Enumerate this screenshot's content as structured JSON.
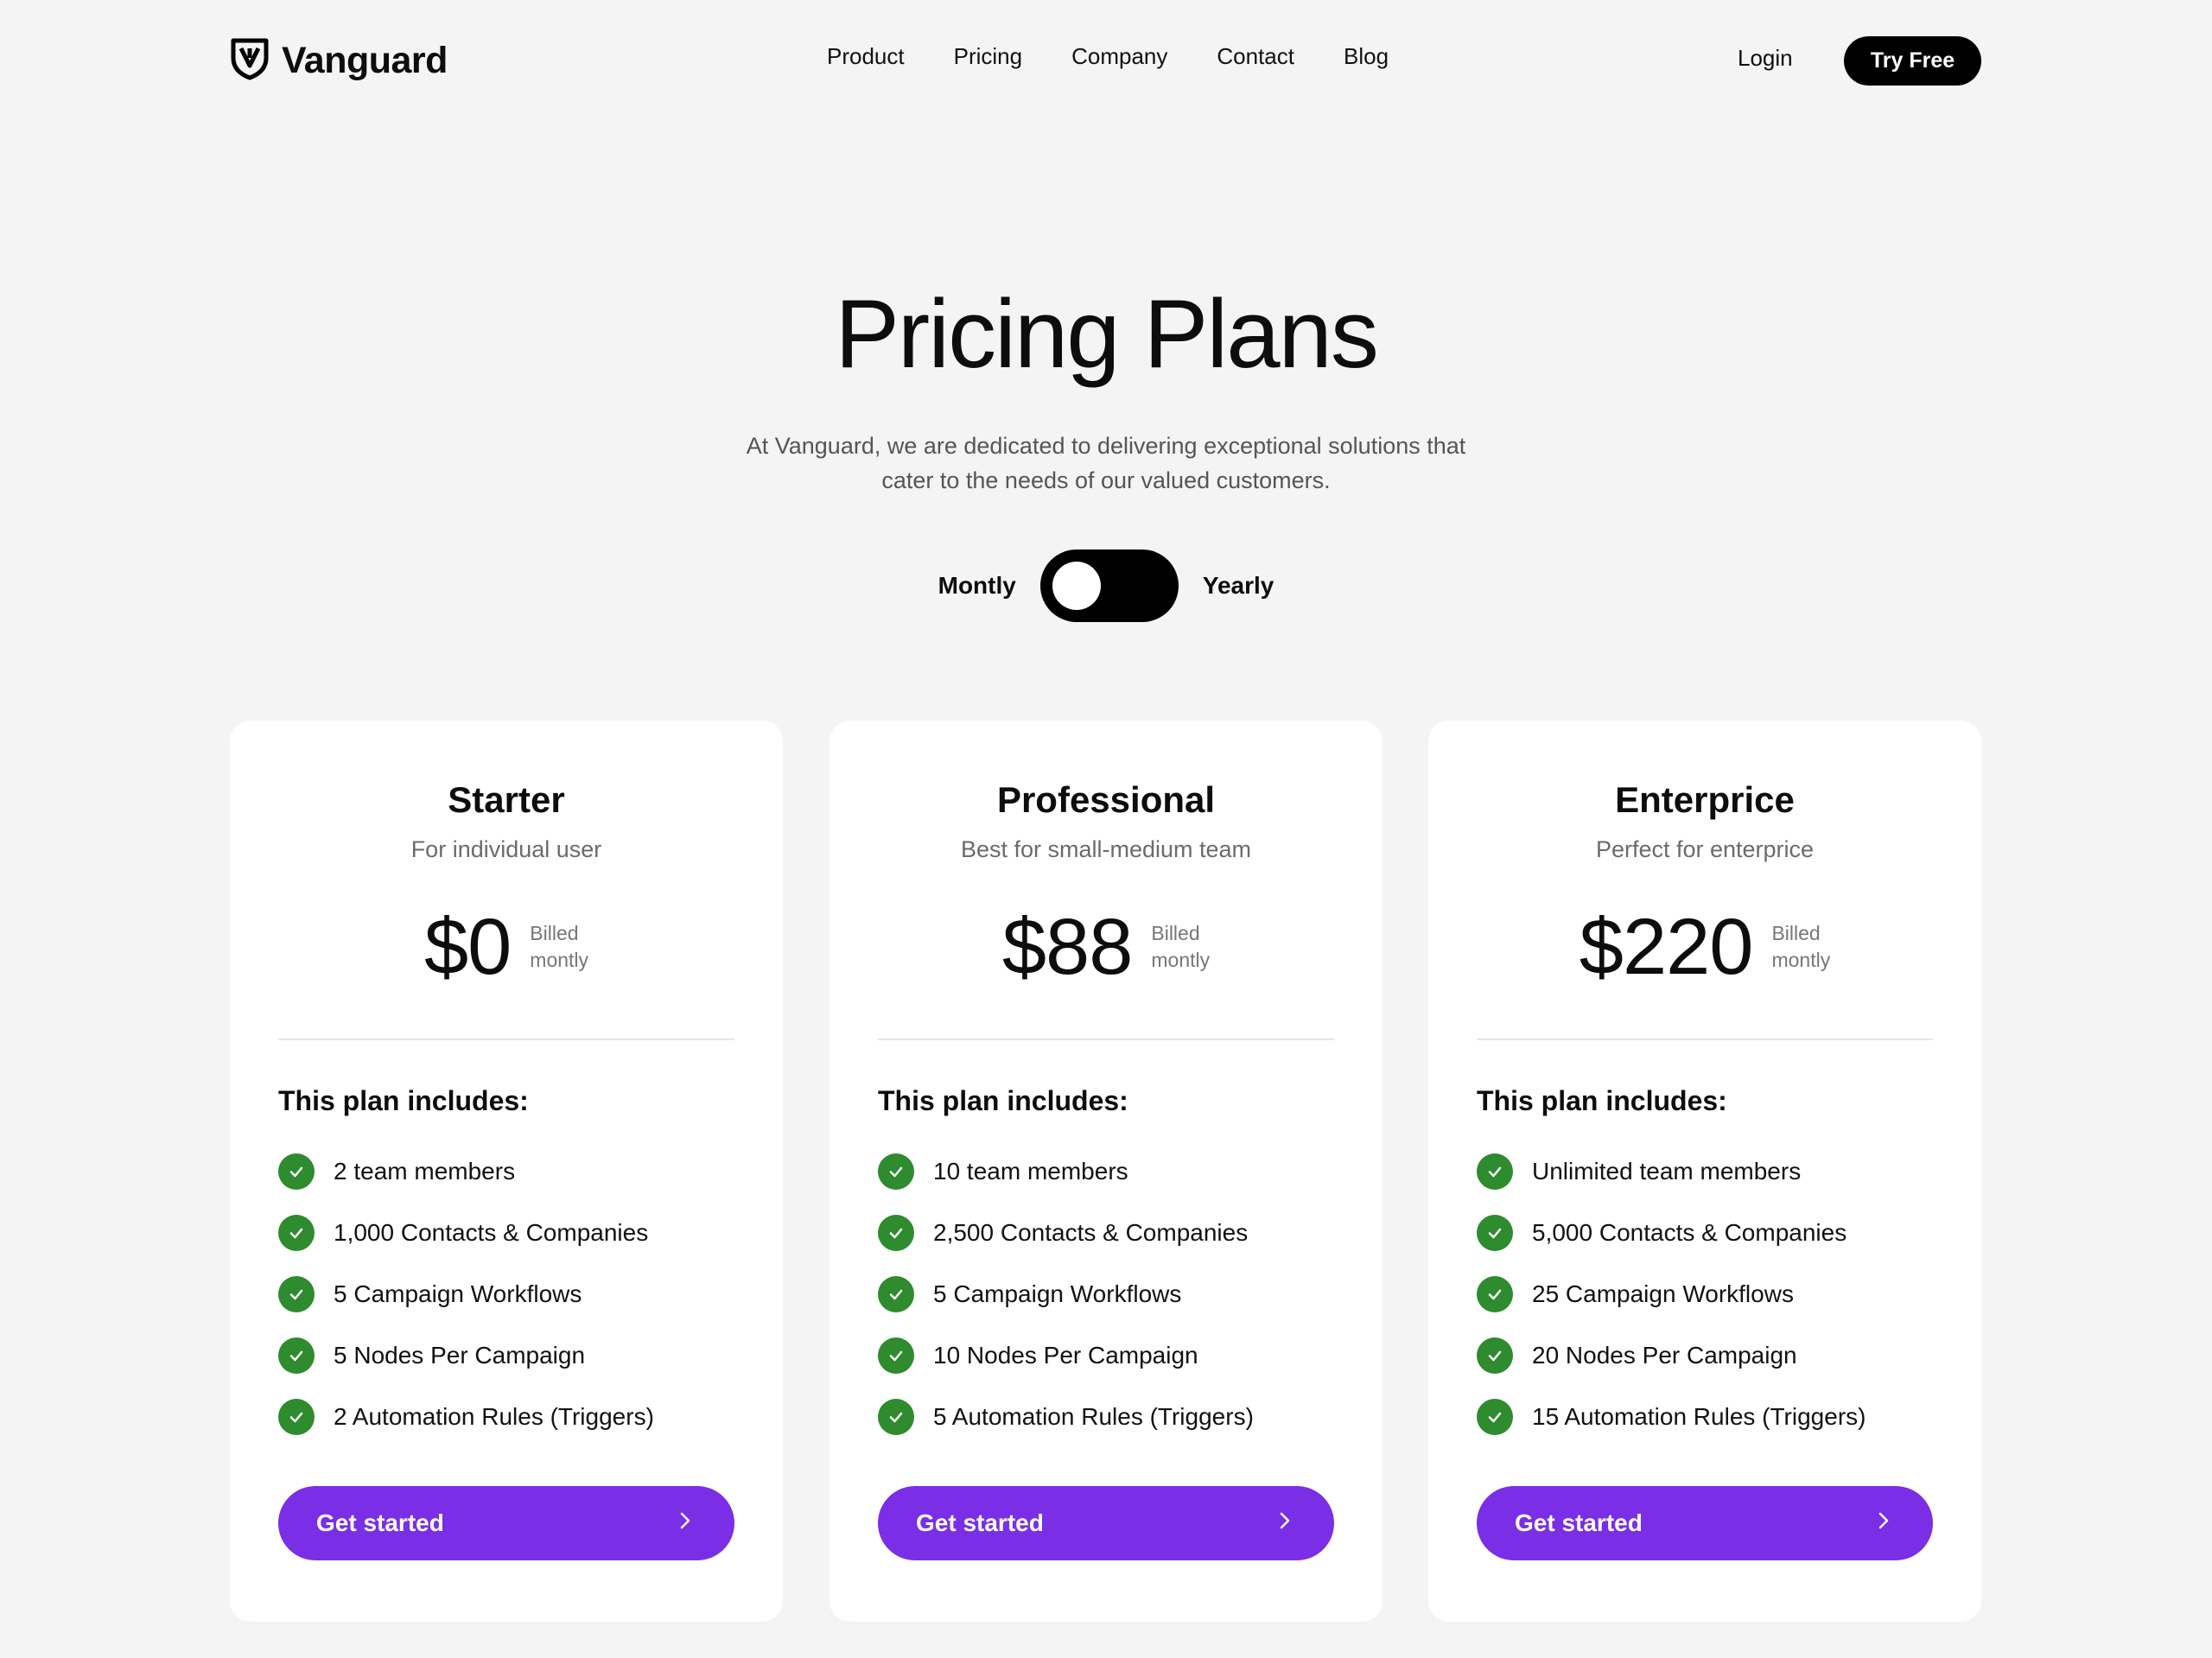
{
  "brand": {
    "name": "Vanguard",
    "logo_icon": "shield-v-icon"
  },
  "nav": {
    "items": [
      "Product",
      "Pricing",
      "Company",
      "Contact",
      "Blog"
    ],
    "login": "Login",
    "try_free": "Try Free"
  },
  "hero": {
    "title": "Pricing Plans",
    "subtitle_line1": "At Vanguard, we are dedicated to delivering exceptional solutions that",
    "subtitle_line2": "cater to the needs of our valued customers."
  },
  "billing_toggle": {
    "left_label": "Montly",
    "right_label": "Yearly",
    "selected": "Montly"
  },
  "plans": [
    {
      "name": "Starter",
      "description": "For individual user",
      "price": "$0",
      "billed_line1": "Billed",
      "billed_line2": "montly",
      "includes_label": "This plan includes:",
      "features": [
        "2 team members",
        "1,000 Contacts & Companies",
        "5 Campaign Workflows",
        "5 Nodes Per Campaign",
        "2 Automation Rules (Triggers)"
      ],
      "cta": "Get started"
    },
    {
      "name": "Professional",
      "description": "Best for small-medium team",
      "price": "$88",
      "billed_line1": "Billed",
      "billed_line2": "montly",
      "includes_label": "This plan includes:",
      "features": [
        "10 team members",
        "2,500 Contacts & Companies",
        "5 Campaign Workflows",
        "10 Nodes Per Campaign",
        "5 Automation Rules (Triggers)"
      ],
      "cta": "Get started"
    },
    {
      "name": "Enterprice",
      "description": "Perfect for enterprice",
      "price": "$220",
      "billed_line1": "Billed",
      "billed_line2": "montly",
      "includes_label": "This plan includes:",
      "features": [
        "Unlimited team members",
        "5,000 Contacts & Companies",
        "25 Campaign Workflows",
        "20 Nodes Per Campaign",
        "15 Automation Rules (Triggers)"
      ],
      "cta": "Get started"
    }
  ],
  "colors": {
    "background": "#f4f4f4",
    "accent_purple": "#7a2ee6",
    "check_green": "#2e8b2e",
    "black": "#000000"
  }
}
